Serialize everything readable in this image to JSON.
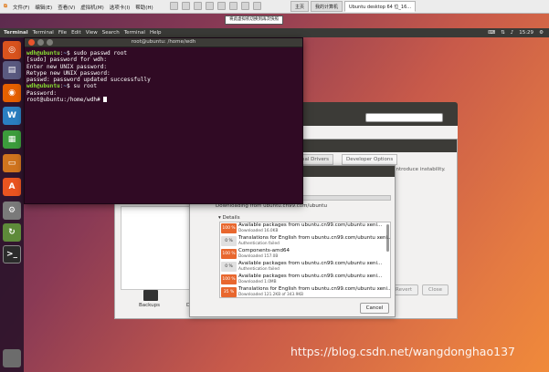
{
  "vmware": {
    "menus": [
      "文件(F)",
      "编辑(E)",
      "查看(V)",
      "虚拟机(M)",
      "选项卡(I)",
      "帮助(H)"
    ],
    "tabs": [
      "主页",
      "我的计算机",
      "Ubuntu desktop 64 位_16..."
    ],
    "tooltip": "将此虚拟机切换到再次快照"
  },
  "top_panel": {
    "app_name": "Terminal",
    "menus": [
      "Terminal",
      "File",
      "Edit",
      "View",
      "Search",
      "Terminal",
      "Help"
    ],
    "clock": "15:29"
  },
  "terminal": {
    "title": "root@ubuntu: /home/wdh",
    "lines": [
      {
        "prompt": "wdh@ubuntu",
        "path": "~",
        "cmd": "$ sudo passwd root"
      },
      {
        "text": "[sudo] password for wdh:"
      },
      {
        "text": "Enter new UNIX password:"
      },
      {
        "text": "Retype new UNIX password:"
      },
      {
        "text": "passwd: password updated successfully"
      },
      {
        "prompt": "wdh@ubuntu",
        "path": "~",
        "cmd": "$ su root"
      },
      {
        "text": "Password:"
      },
      {
        "text": "root@ubuntu:/home/wdh#"
      }
    ]
  },
  "software_window": {
    "tabs": [
      "tional Drivers",
      "Developer Options"
    ],
    "hint": "introduce instability.",
    "revert_label": "Revert",
    "close_label": "Close",
    "backups_label": "Backups",
    "de_label": "De"
  },
  "download_dialog": {
    "caption": "Downloading from ubuntu.cn99.com/ubuntu",
    "details_label": "▾ Details",
    "items": [
      {
        "pct": "100 %",
        "state": "done",
        "name": "Available packages from ubuntu.cn99.com/ubuntu xeni...",
        "status": "Downloaded 16.0KB"
      },
      {
        "pct": "0 %",
        "state": "pending",
        "name": "Translations for English from ubuntu.cn99.com/ubuntu xeni...",
        "status": "Authentication failed"
      },
      {
        "pct": "100 %",
        "state": "done",
        "name": "Components-amd64",
        "status": "Downloaded 157.0B"
      },
      {
        "pct": "0 %",
        "state": "pending",
        "name": "Available packages from ubuntu.cn99.com/ubuntu xeni...",
        "status": "Authentication failed"
      },
      {
        "pct": "100 %",
        "state": "done",
        "name": "Available packages from ubuntu.cn99.com/ubuntu xeni...",
        "status": "Downloaded 1.0MB"
      },
      {
        "pct": "35 %",
        "state": "done",
        "name": "Translations for English from ubuntu.cn99.com/ubuntu xeni...",
        "status": "Downloaded 121.2KB of 343.9KB"
      }
    ],
    "cancel_label": "Cancel"
  },
  "watermark": "https://blog.csdn.net/wangdonghao137",
  "colors": {
    "terminal_bg": "#300a24",
    "prompt_user": "#8ae234",
    "prompt_path": "#729fcf",
    "accent": "#e8672e"
  }
}
